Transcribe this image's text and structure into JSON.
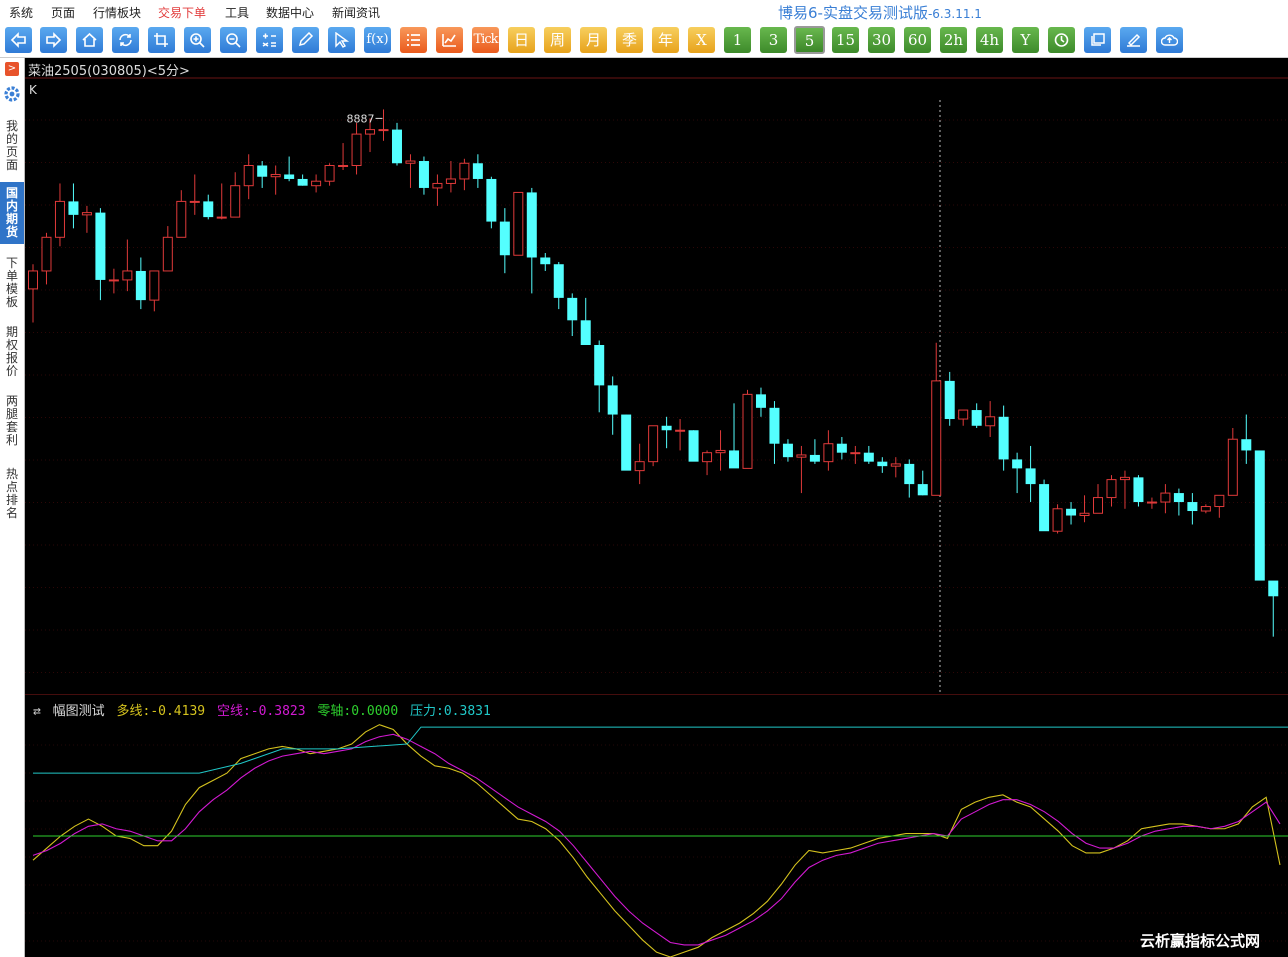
{
  "menu": [
    "系统",
    "页面",
    "行情板块",
    "交易下单",
    "工具",
    "数据中心",
    "新闻资讯"
  ],
  "app": {
    "title": "博易6-实盘交易测试版",
    "version": "-6.3.11.1"
  },
  "toolbar": {
    "periods": [
      "Tick",
      "日",
      "周",
      "月",
      "季",
      "年",
      "X",
      "1",
      "3",
      "5",
      "15",
      "30",
      "60",
      "2h",
      "4h",
      "Y"
    ],
    "selected_period": "5"
  },
  "sidebar": {
    "tabs": [
      "我的页面",
      "国内期货",
      "下单模板",
      "期权报价",
      "两腿套利",
      "热点排名"
    ],
    "active_tab": "国内期货"
  },
  "instrument": {
    "name": "菜油2505(030805)",
    "period": "<5分>"
  },
  "main_chart": {
    "label": "K",
    "high_marker": "8887"
  },
  "indicator": {
    "name": "幅图测试",
    "items": [
      {
        "label": "多线:",
        "value": "-0.4139",
        "color": "#d4c21e"
      },
      {
        "label": "空线:",
        "value": "-0.3823",
        "color": "#d21ad2"
      },
      {
        "label": "零轴:",
        "value": "0.0000",
        "color": "#2ed02e"
      },
      {
        "label": "压力:",
        "value": "0.3831",
        "color": "#20c8c8"
      }
    ]
  },
  "chart_data": [
    {
      "type": "candlestick",
      "title": "菜油2505(030805) <5分>",
      "ylim": [
        8630,
        8905
      ],
      "annotations": [
        {
          "text": "8887",
          "value": 8887
        }
      ],
      "candles": [
        [
          8811,
          8822,
          8796,
          8819
        ],
        [
          8819,
          8836,
          8813,
          8834
        ],
        [
          8834,
          8858,
          8830,
          8850
        ],
        [
          8850,
          8858,
          8838,
          8844
        ],
        [
          8844,
          8848,
          8836,
          8845
        ],
        [
          8845,
          8847,
          8806,
          8815
        ],
        [
          8815,
          8820,
          8809,
          8815
        ],
        [
          8815,
          8833,
          8810,
          8819
        ],
        [
          8819,
          8825,
          8802,
          8806
        ],
        [
          8806,
          8819,
          8801,
          8819
        ],
        [
          8819,
          8839,
          8819,
          8834
        ],
        [
          8834,
          8855,
          8834,
          8850
        ],
        [
          8850,
          8862,
          8844,
          8850
        ],
        [
          8850,
          8853,
          8842,
          8843
        ],
        [
          8843,
          8858,
          8842,
          8843
        ],
        [
          8843,
          8863,
          8843,
          8857
        ],
        [
          8857,
          8871,
          8851,
          8866
        ],
        [
          8866,
          8868,
          8856,
          8861
        ],
        [
          8861,
          8866,
          8853,
          8862
        ],
        [
          8862,
          8870,
          8859,
          8860
        ],
        [
          8860,
          8862,
          8857,
          8857
        ],
        [
          8857,
          8862,
          8854,
          8859
        ],
        [
          8859,
          8867,
          8857,
          8866
        ],
        [
          8866,
          8876,
          8864,
          8866
        ],
        [
          8866,
          8885,
          8862,
          8880
        ],
        [
          8880,
          8887,
          8872,
          8882
        ],
        [
          8882,
          8891,
          8877,
          8882
        ],
        [
          8882,
          8885,
          8866,
          8867
        ],
        [
          8867,
          8871,
          8856,
          8868
        ],
        [
          8868,
          8870,
          8853,
          8856
        ],
        [
          8856,
          8862,
          8848,
          8858
        ],
        [
          8858,
          8868,
          8854,
          8860
        ],
        [
          8860,
          8869,
          8855,
          8867
        ],
        [
          8867,
          8871,
          8856,
          8860
        ],
        [
          8860,
          8861,
          8838,
          8841
        ],
        [
          8841,
          8847,
          8818,
          8826
        ],
        [
          8826,
          8854,
          8826,
          8854
        ],
        [
          8854,
          8856,
          8809,
          8825
        ],
        [
          8825,
          8827,
          8819,
          8822
        ],
        [
          8822,
          8823,
          8802,
          8807
        ],
        [
          8807,
          8809,
          8790,
          8797
        ],
        [
          8797,
          8807,
          8792,
          8786
        ],
        [
          8786,
          8788,
          8756,
          8768
        ],
        [
          8768,
          8772,
          8746,
          8755
        ],
        [
          8755,
          8755,
          8736,
          8730
        ],
        [
          8730,
          8742,
          8724,
          8734
        ],
        [
          8734,
          8750,
          8732,
          8750
        ],
        [
          8750,
          8754,
          8740,
          8748
        ],
        [
          8748,
          8753,
          8739,
          8748
        ],
        [
          8748,
          8748,
          8735,
          8734
        ],
        [
          8734,
          8739,
          8728,
          8738
        ],
        [
          8738,
          8748,
          8730,
          8739
        ],
        [
          8739,
          8760,
          8733,
          8731
        ],
        [
          8731,
          8766,
          8731,
          8764
        ],
        [
          8764,
          8767,
          8754,
          8758
        ],
        [
          8758,
          8761,
          8733,
          8742
        ],
        [
          8742,
          8744,
          8734,
          8736
        ],
        [
          8736,
          8741,
          8720,
          8737
        ],
        [
          8737,
          8744,
          8733,
          8734
        ],
        [
          8734,
          8748,
          8730,
          8742
        ],
        [
          8742,
          8745,
          8735,
          8738
        ],
        [
          8738,
          8741,
          8733,
          8738
        ],
        [
          8738,
          8741,
          8733,
          8734
        ],
        [
          8734,
          8736,
          8729,
          8732
        ],
        [
          8732,
          8736,
          8727,
          8733
        ],
        [
          8733,
          8735,
          8718,
          8724
        ],
        [
          8724,
          8730,
          8719,
          8719
        ],
        [
          8719,
          8787,
          8719,
          8770
        ],
        [
          8770,
          8774,
          8750,
          8753
        ],
        [
          8753,
          8757,
          8750,
          8757
        ],
        [
          8757,
          8760,
          8749,
          8750
        ],
        [
          8750,
          8761,
          8745,
          8754
        ],
        [
          8754,
          8759,
          8730,
          8735
        ],
        [
          8735,
          8738,
          8720,
          8731
        ],
        [
          8731,
          8741,
          8716,
          8724
        ],
        [
          8724,
          8726,
          8704,
          8703
        ],
        [
          8703,
          8715,
          8702,
          8713
        ],
        [
          8713,
          8716,
          8706,
          8710
        ],
        [
          8710,
          8719,
          8707,
          8711
        ],
        [
          8711,
          8724,
          8711,
          8718
        ],
        [
          8718,
          8728,
          8714,
          8726
        ],
        [
          8726,
          8730,
          8713,
          8727
        ],
        [
          8727,
          8728,
          8714,
          8716
        ],
        [
          8716,
          8718,
          8713,
          8716
        ],
        [
          8716,
          8724,
          8711,
          8720
        ],
        [
          8720,
          8722,
          8710,
          8716
        ],
        [
          8716,
          8720,
          8706,
          8712
        ],
        [
          8712,
          8715,
          8711,
          8714
        ],
        [
          8714,
          8718,
          8709,
          8719
        ],
        [
          8719,
          8749,
          8719,
          8744
        ],
        [
          8744,
          8755,
          8733,
          8739
        ],
        [
          8739,
          8738,
          8693,
          8681
        ],
        [
          8681,
          8680,
          8656,
          8674
        ]
      ]
    },
    {
      "type": "line",
      "title": "幅图测试",
      "ylim": [
        -0.5,
        0.5
      ],
      "series": [
        {
          "name": "多线",
          "color": "#d4c21e",
          "values": [
            -0.1,
            -0.05,
            0.0,
            0.04,
            0.07,
            0.04,
            0.0,
            -0.01,
            -0.04,
            -0.04,
            0.02,
            0.13,
            0.2,
            0.23,
            0.26,
            0.32,
            0.34,
            0.36,
            0.37,
            0.36,
            0.34,
            0.35,
            0.36,
            0.38,
            0.43,
            0.46,
            0.44,
            0.38,
            0.33,
            0.29,
            0.28,
            0.26,
            0.22,
            0.17,
            0.12,
            0.07,
            0.06,
            0.03,
            -0.02,
            -0.09,
            -0.17,
            -0.24,
            -0.31,
            -0.37,
            -0.43,
            -0.48,
            -0.5,
            -0.48,
            -0.46,
            -0.42,
            -0.39,
            -0.36,
            -0.32,
            -0.27,
            -0.2,
            -0.12,
            -0.06,
            -0.07,
            -0.06,
            -0.05,
            -0.03,
            -0.01,
            0.0,
            0.01,
            0.01,
            0.01,
            -0.01,
            0.11,
            0.14,
            0.16,
            0.17,
            0.14,
            0.12,
            0.07,
            0.02,
            -0.04,
            -0.07,
            -0.07,
            -0.05,
            -0.02,
            0.03,
            0.04,
            0.05,
            0.05,
            0.04,
            0.03,
            0.03,
            0.05,
            0.12,
            0.16,
            -0.12
          ]
        },
        {
          "name": "空线",
          "color": "#d21ad2",
          "values": [
            -0.08,
            -0.06,
            -0.03,
            0.01,
            0.04,
            0.05,
            0.03,
            0.02,
            0.0,
            -0.02,
            -0.02,
            0.03,
            0.1,
            0.15,
            0.19,
            0.24,
            0.28,
            0.31,
            0.33,
            0.34,
            0.35,
            0.34,
            0.35,
            0.36,
            0.39,
            0.41,
            0.42,
            0.4,
            0.37,
            0.34,
            0.3,
            0.27,
            0.24,
            0.2,
            0.16,
            0.12,
            0.09,
            0.06,
            0.02,
            -0.04,
            -0.11,
            -0.18,
            -0.25,
            -0.31,
            -0.36,
            -0.4,
            -0.44,
            -0.45,
            -0.45,
            -0.43,
            -0.41,
            -0.38,
            -0.35,
            -0.31,
            -0.26,
            -0.19,
            -0.13,
            -0.1,
            -0.08,
            -0.07,
            -0.05,
            -0.03,
            -0.02,
            -0.01,
            0.0,
            0.01,
            0.0,
            0.07,
            0.1,
            0.13,
            0.15,
            0.15,
            0.13,
            0.1,
            0.06,
            0.01,
            -0.03,
            -0.05,
            -0.05,
            -0.03,
            0.0,
            0.02,
            0.03,
            0.04,
            0.04,
            0.03,
            0.04,
            0.06,
            0.1,
            0.14,
            0.05
          ]
        },
        {
          "name": "零轴",
          "color": "#2ed02e",
          "constant": 0.0
        },
        {
          "name": "压力",
          "color": "#20c8c8",
          "step": [
            [
              0,
              0.26
            ],
            [
              12,
              0.26
            ],
            [
              15,
              0.3
            ],
            [
              18,
              0.36
            ],
            [
              22,
              0.36
            ],
            [
              27,
              0.38
            ],
            [
              28,
              0.45
            ],
            [
              30,
              0.45
            ],
            [
              91,
              0.45
            ]
          ]
        }
      ]
    }
  ]
}
